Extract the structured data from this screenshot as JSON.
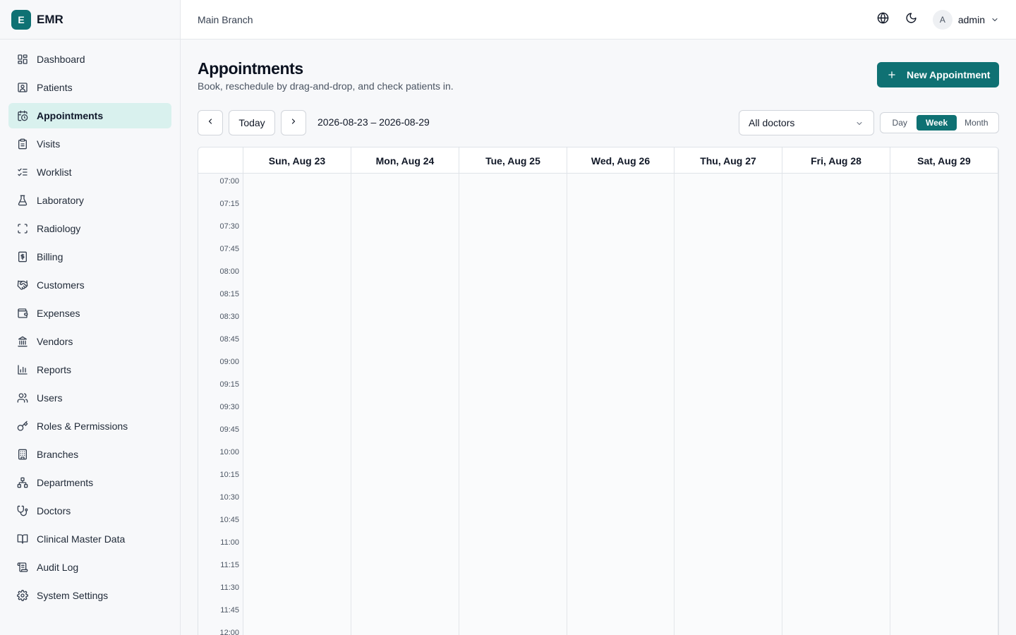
{
  "brand": {
    "logo_letter": "E",
    "name": "EMR"
  },
  "topbar": {
    "branch": "Main Branch",
    "user_initial": "A",
    "username": "admin"
  },
  "sidebar": {
    "items": [
      {
        "label": "Dashboard",
        "icon": "dashboard-icon",
        "active": false
      },
      {
        "label": "Patients",
        "icon": "patient-id-icon",
        "active": false
      },
      {
        "label": "Appointments",
        "icon": "calendar-clock-icon",
        "active": true
      },
      {
        "label": "Visits",
        "icon": "clipboard-icon",
        "active": false
      },
      {
        "label": "Worklist",
        "icon": "list-checks-icon",
        "active": false
      },
      {
        "label": "Laboratory",
        "icon": "flask-icon",
        "active": false
      },
      {
        "label": "Radiology",
        "icon": "scan-icon",
        "active": false
      },
      {
        "label": "Billing",
        "icon": "receipt-icon",
        "active": false
      },
      {
        "label": "Customers",
        "icon": "handshake-icon",
        "active": false
      },
      {
        "label": "Expenses",
        "icon": "wallet-icon",
        "active": false
      },
      {
        "label": "Vendors",
        "icon": "bank-icon",
        "active": false
      },
      {
        "label": "Reports",
        "icon": "bar-chart-icon",
        "active": false
      },
      {
        "label": "Users",
        "icon": "users-icon",
        "active": false
      },
      {
        "label": "Roles & Permissions",
        "icon": "key-icon",
        "active": false
      },
      {
        "label": "Branches",
        "icon": "building-icon",
        "active": false
      },
      {
        "label": "Departments",
        "icon": "network-icon",
        "active": false
      },
      {
        "label": "Doctors",
        "icon": "stethoscope-icon",
        "active": false
      },
      {
        "label": "Clinical Master Data",
        "icon": "book-icon",
        "active": false
      },
      {
        "label": "Audit Log",
        "icon": "scroll-icon",
        "active": false
      },
      {
        "label": "System Settings",
        "icon": "gear-icon",
        "active": false
      }
    ]
  },
  "page": {
    "title": "Appointments",
    "subtitle": "Book, reschedule by drag-and-drop, and check patients in.",
    "new_button": "New Appointment"
  },
  "toolbar": {
    "today": "Today",
    "range": "2026-08-23 – 2026-08-29",
    "doctor_filter": "All doctors",
    "views": [
      "Day",
      "Week",
      "Month"
    ],
    "active_view": "Week"
  },
  "calendar": {
    "days": [
      "Sun, Aug 23",
      "Mon, Aug 24",
      "Tue, Aug 25",
      "Wed, Aug 26",
      "Thu, Aug 27",
      "Fri, Aug 28",
      "Sat, Aug 29"
    ],
    "times": [
      "07:00",
      "07:15",
      "07:30",
      "07:45",
      "08:00",
      "08:15",
      "08:30",
      "08:45",
      "09:00",
      "09:15",
      "09:30",
      "09:45",
      "10:00",
      "10:15",
      "10:30",
      "10:45",
      "11:00",
      "11:15",
      "11:30",
      "11:45",
      "12:00"
    ]
  },
  "colors": {
    "accent": "#0f7173",
    "active_nav_bg": "#d9f1ee"
  }
}
